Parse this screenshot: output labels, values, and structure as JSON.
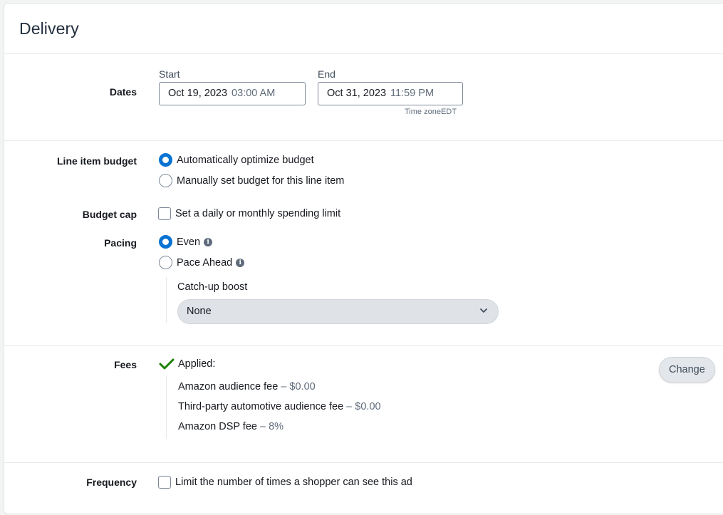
{
  "header": {
    "title": "Delivery"
  },
  "dates": {
    "label": "Dates",
    "start_label": "Start",
    "start_date": "Oct 19, 2023",
    "start_time": "03:00 AM",
    "end_label": "End",
    "end_date": "Oct 31, 2023",
    "end_time": "11:59 PM",
    "timezone_label": "Time zone",
    "timezone": "EDT"
  },
  "budget": {
    "label": "Line item budget",
    "options": [
      "Automatically optimize budget",
      "Manually set budget for this line item"
    ],
    "selected": 0
  },
  "budget_cap": {
    "label": "Budget cap",
    "checkbox_label": "Set a daily or monthly spending limit",
    "checked": false
  },
  "pacing": {
    "label": "Pacing",
    "options": [
      "Even",
      "Pace Ahead"
    ],
    "selected": 0,
    "catchup_label": "Catch-up boost",
    "catchup_value": "None"
  },
  "fees": {
    "label": "Fees",
    "status": "Applied:",
    "items": [
      {
        "name": "Amazon audience fee",
        "sep": "–",
        "value": "$0.00"
      },
      {
        "name": "Third-party automotive audience fee",
        "sep": "–",
        "value": "$0.00"
      },
      {
        "name": "Amazon DSP fee",
        "sep": "–",
        "value": "8%"
      }
    ],
    "change_label": "Change"
  },
  "frequency": {
    "label": "Frequency",
    "checkbox_label": "Limit the number of times a shopper can see this ad",
    "checked": false
  },
  "colors": {
    "accent": "#0972d3",
    "success": "#1d8102"
  },
  "icons": {
    "info": "info-icon",
    "check": "checkmark-icon",
    "chevron": "chevron-down-icon"
  }
}
